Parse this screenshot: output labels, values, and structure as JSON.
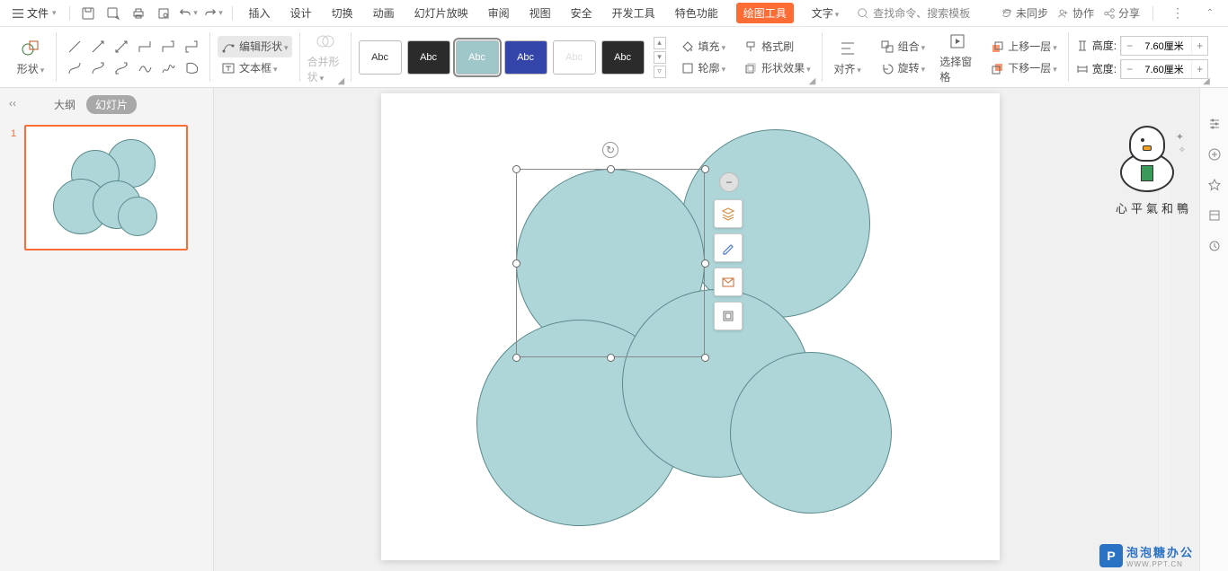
{
  "menubar": {
    "file": "文件",
    "tabs": [
      "插入",
      "设计",
      "切换",
      "动画",
      "幻灯片放映",
      "审阅",
      "视图",
      "安全",
      "开发工具",
      "特色功能",
      "绘图工具",
      "文字"
    ],
    "active_tab_index": 10,
    "search_placeholder": "查找命令、搜索模板",
    "not_synced": "未同步",
    "collab": "协作",
    "share": "分享"
  },
  "ribbon": {
    "shape": "形状",
    "edit_shape": "编辑形状",
    "text_box": "文本框",
    "merge_shapes": "合并形状",
    "style_abc": "Abc",
    "fill": "填充",
    "outline": "轮廓",
    "format_painter": "格式刷",
    "shape_effects": "形状效果",
    "align": "对齐",
    "group": "组合",
    "rotate": "旋转",
    "selection_pane": "选择窗格",
    "bring_forward": "上移一层",
    "send_backward": "下移一层",
    "height_label": "高度:",
    "width_label": "宽度:",
    "height_value": "7.60厘米",
    "width_value": "7.60厘米"
  },
  "side": {
    "outline": "大纲",
    "slides": "幻灯片",
    "slide_number": "1"
  },
  "duck_text": "心平氣和鴨",
  "watermark": {
    "brand": "泡泡糖办公",
    "url": "WWW.PPT.CN"
  }
}
